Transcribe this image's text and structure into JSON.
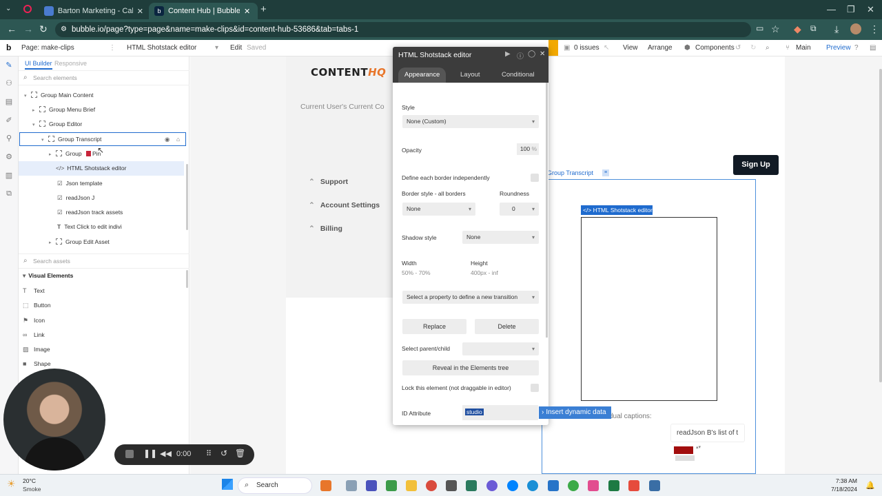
{
  "browser": {
    "tabs": [
      {
        "title": "Barton Marketing - Calendar - ",
        "active": false
      },
      {
        "title": "Content Hub | Bubble Editor",
        "active": true
      }
    ],
    "url": "bubble.io/page?type=page&name=make-clips&id=content-hub-53686&tab=tabs-1"
  },
  "bubble_bar": {
    "page": "Page: make-clips",
    "element": "HTML Shotstack editor",
    "edit": "Edit",
    "saved": "Saved",
    "issues": "0 issues",
    "view": "View",
    "arrange": "Arrange",
    "components": "Components",
    "branch": "Main",
    "preview": "Preview"
  },
  "left_panel": {
    "tab_ui_builder": "UI Builder",
    "tab_responsive": "Responsive",
    "search_elements_placeholder": "Search elements",
    "tree": [
      {
        "label": "Group Main Content"
      },
      {
        "label": "Group Menu Brief"
      },
      {
        "label": "Group Editor"
      },
      {
        "label": "Group Transcript"
      },
      {
        "label": "Group"
      },
      {
        "label": "Pin"
      },
      {
        "label": "HTML Shotstack editor"
      },
      {
        "label": "Json template"
      },
      {
        "label": "readJson J"
      },
      {
        "label": "readJson track assets"
      },
      {
        "label": "Text Click to edit indivi"
      },
      {
        "label": "Group Edit Asset"
      }
    ],
    "search_assets_placeholder": "Search assets",
    "visual_elements_title": "Visual Elements",
    "visual_elements": [
      "Text",
      "Button",
      "Icon",
      "Link",
      "Image",
      "Shape"
    ]
  },
  "canvas": {
    "logo_text": "CONTENT",
    "logo_accent": "HQ",
    "user_text": "Current User's Current Co",
    "menu": [
      "Support",
      "Account Settings",
      "Billing"
    ],
    "signup": "Sign Up",
    "group_label": "Group Transcript",
    "html_label": "</> HTML Shotstack editor",
    "captions_text": "dual captions:",
    "readjson_text": "readJson B's list of t"
  },
  "popup": {
    "title": "HTML Shotstack editor",
    "tabs": [
      "Appearance",
      "Layout",
      "Conditional"
    ],
    "style_label": "Style",
    "style_value": "None (Custom)",
    "opacity_label": "Opacity",
    "opacity_value": "100",
    "opacity_unit": "%",
    "border_independent_label": "Define each border independently",
    "border_style_label": "Border style - all borders",
    "border_style_value": "None",
    "roundness_label": "Roundness",
    "roundness_value": "0",
    "shadow_label": "Shadow style",
    "shadow_value": "None",
    "width_label": "Width",
    "width_value": "50% - 70%",
    "height_label": "Height",
    "height_value": "400px - inf",
    "transition_placeholder": "Select a property to define a new transition",
    "replace": "Replace",
    "delete": "Delete",
    "parent_child_label": "Select parent/child",
    "reveal": "Reveal in the Elements tree",
    "lock_label": "Lock this element (not draggable in editor)",
    "id_label": "ID Attribute",
    "id_value": "studio",
    "dynamic": "Insert dynamic data"
  },
  "recorder": {
    "time": "0:00"
  },
  "taskbar": {
    "weather_temp": "20°C",
    "weather_desc": "Smoke",
    "search": "Search",
    "time": "7:38 AM",
    "date": "7/18/2024"
  },
  "colors": {
    "chrome_dark": "#1f3d3b",
    "chrome_mid": "#2d5753",
    "bubble_blue": "#1f6bce",
    "accent_orange": "#e8762b"
  }
}
